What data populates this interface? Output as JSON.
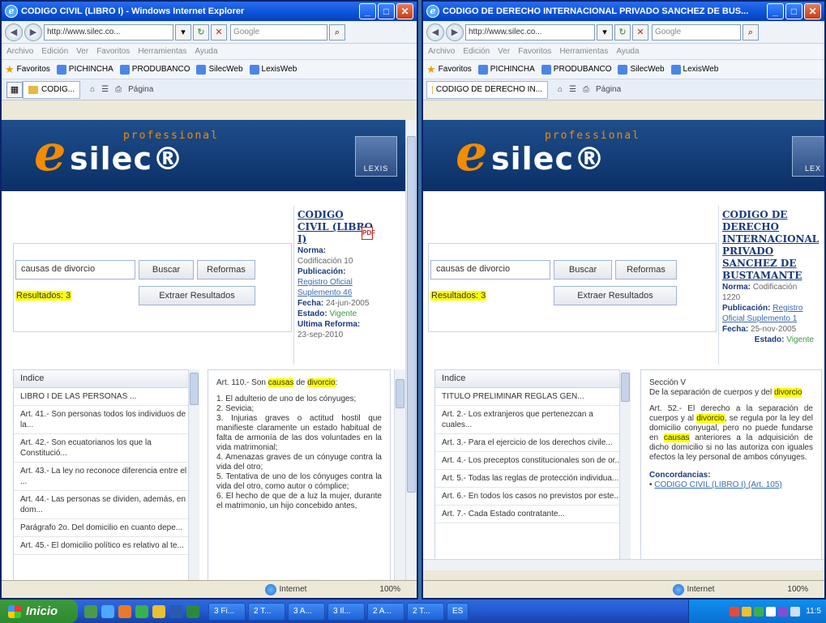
{
  "left_window": {
    "title": "CODIGO CIVIL (LIBRO I) - Windows Internet Explorer",
    "url": "http://www.silec.co...",
    "search_placeholder": "Google",
    "menu": [
      "Archivo",
      "Edición",
      "Ver",
      "Favoritos",
      "Herramientas",
      "Ayuda"
    ],
    "favorites_label": "Favoritos",
    "favorites": [
      "PICHINCHA",
      "PRODUBANCO",
      "SilecWeb",
      "LexisWeb"
    ],
    "tab_label": "CODIG...",
    "page_menu": "Página",
    "search_query": "causas de divorcio",
    "buscar": "Buscar",
    "reformas": "Reformas",
    "extraer": "Extraer Resultados",
    "results": "Resultados: 3",
    "doc_title": "CODIGO CIVIL (LIBRO I)",
    "norma_label": "Norma:",
    "norma_value": "Codificación 10",
    "publicacion_label": "Publicación:",
    "publicacion_value": "Registro Oficial Suplemento 46",
    "fecha_label": "Fecha:",
    "fecha_value": "24-jun-2005",
    "estado_label": "Estado:",
    "estado_value": "Vigente",
    "ultima_label": "Ultima Reforma:",
    "ultima_value": "23-sep-2010",
    "index_header": "Indice",
    "index_items": [
      "LIBRO I DE LAS PERSONAS ...",
      "Art. 41.- Son personas todos los individuos de la...",
      "Art. 42.- Son ecuatorianos los que la Constitució...",
      "Art. 43.- La ley no reconoce diferencia entre el ...",
      "Art. 44.- Las personas se dividen, además, en dom...",
      "Parágrafo 2o. Del domicilio en cuanto depe...",
      "Art. 45.- El domicilio político es relativo al te..."
    ],
    "article": {
      "intro": "Art. 110.- Son",
      "hl1": "causas",
      "mid": "de",
      "hl2": "divorcio",
      "colon": ":",
      "body": "1. El adulterio de uno de los cónyuges;\n2. Sevicia;\n3. Injurias graves o actitud hostil que manifieste claramente un estado habitual de falta de armonía de las dos voluntades en la vida matrimonial;\n4. Amenazas graves de un cónyuge contra la vida del otro;\n5. Tentativa de uno de los cónyuges contra la vida del otro, como autor o cómplice;\n6. El hecho de que de a luz la mujer, durante el matrimonio, un hijo concebido antes,"
    },
    "status_zone": "Internet",
    "zoom": "100%"
  },
  "right_window": {
    "title": "CODIGO DE DERECHO INTERNACIONAL PRIVADO SANCHEZ DE BUS...",
    "url": "http://www.silec.co...",
    "search_placeholder": "Google",
    "menu": [
      "Archivo",
      "Edición",
      "Ver",
      "Favoritos",
      "Herramientas",
      "Ayuda"
    ],
    "favorites_label": "Favoritos",
    "favorites": [
      "PICHINCHA",
      "PRODUBANCO",
      "SilecWeb",
      "LexisWeb"
    ],
    "tab_label": "CODIGO DE DERECHO IN...",
    "page_menu": "Página",
    "search_query": "causas de divorcio",
    "buscar": "Buscar",
    "reformas": "Reformas",
    "extraer": "Extraer Resultados",
    "results": "Resultados: 3",
    "doc_title": "CODIGO DE DERECHO INTERNACIONAL PRIVADO SANCHEZ DE BUSTAMANTE",
    "norma_label": "Norma:",
    "norma_value": "Codificación 1220",
    "publicacion_label": "Publicación:",
    "publicacion_value": "Registro Oficial Suplemento 1",
    "fecha_label": "Fecha:",
    "fecha_value": "25-nov-2005",
    "estado_label": "Estado:",
    "estado_value": "Vigente",
    "index_header": "Indice",
    "index_items": [
      "TITULO PRELIMINAR REGLAS GEN...",
      "Art. 2.- Los extranjeros que pertenezcan a cuales...",
      "Art. 3.- Para el ejercicio de los derechos civile...",
      "Art. 4.- Los preceptos constitucionales son de or...",
      "Art. 5.- Todas las reglas de protección individua...",
      "Art. 6.- En todos los casos no previstos por este...",
      "Art. 7.- Cada Estado contratante..."
    ],
    "article": {
      "section": "Sección V",
      "section_title_a": "De la separación de cuerpos y del",
      "section_hl": "divorcio",
      "art_intro": "Art. 52.- El derecho a la separación de cuerpos y al",
      "hl1": "divorcio",
      "body_a": ", se regula por la ley del domicilio conyugal, pero no puede fundarse en",
      "hl2": "causas",
      "body_b": "anteriores a la adquisición de dicho domicilio si no las autoriza con iguales efectos la ley personal de ambos cónyuges.",
      "concordancias": "Concordancias:",
      "conc_link": "CODIGO CIVIL (LIBRO I) (Art. 105)"
    },
    "status_zone": "Internet",
    "zoom": "100%"
  },
  "taskbar": {
    "start": "Inicio",
    "items": [
      "3 Fi...",
      "2 T...",
      "3 A...",
      "3 Il...",
      "2 A...",
      "2 T...",
      "ES"
    ],
    "clock": "11:5"
  },
  "colors": {
    "banner": "#0b2f66",
    "logo_orange": "#f28c00",
    "highlight": "#ffff00",
    "link_blue": "#3a6ab0",
    "vigente_green": "#3a9a3a"
  }
}
